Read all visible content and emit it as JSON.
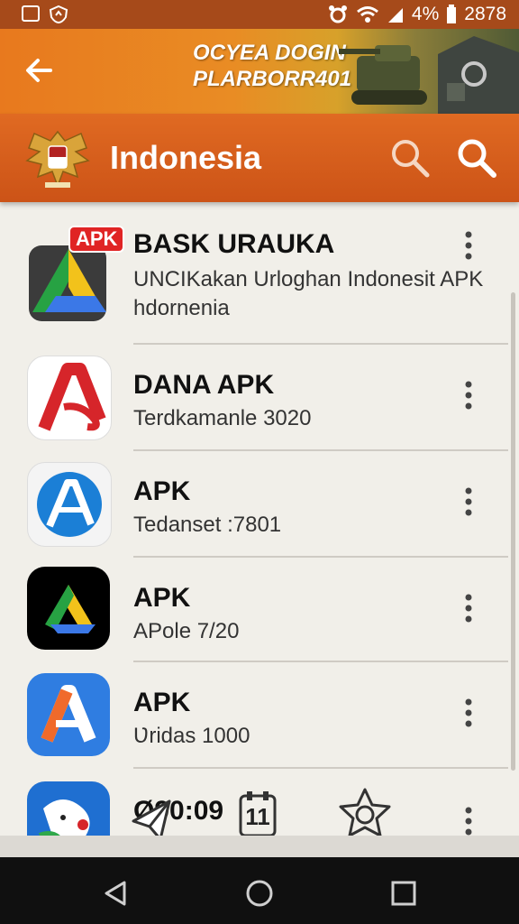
{
  "status_bar": {
    "battery": "4%",
    "time": "2878"
  },
  "banner": {
    "line1": "OCYEA DOGIN",
    "line2": "PLARBORR401"
  },
  "header": {
    "title": "Indonesia"
  },
  "apps": [
    {
      "title": "BASK URAUKA",
      "subtitle": "UNCIKakan Urloghan Indonesit APK",
      "subtitle2": "hdornenia",
      "badge": "APK",
      "icon": "drive-like-icon"
    },
    {
      "title": "DANA APK",
      "subtitle": "Terdkamanle 3020",
      "icon": "red-a-icon"
    },
    {
      "title": "APK",
      "subtitle": "Tedanset :7801",
      "icon": "blue-a-icon"
    },
    {
      "title": "APK",
      "subtitle": "APolе 7/20",
      "icon": "drive-dark-icon"
    },
    {
      "title": "APK",
      "subtitle": "Ʋridas 1000",
      "icon": "orange-a-icon"
    },
    {
      "title": "Ø90:09",
      "icon": "bird-icon",
      "overlay_number": "11"
    }
  ],
  "colors": {
    "header": "#d85f1d",
    "banner": "#e8791e",
    "background": "#f1efe9"
  }
}
